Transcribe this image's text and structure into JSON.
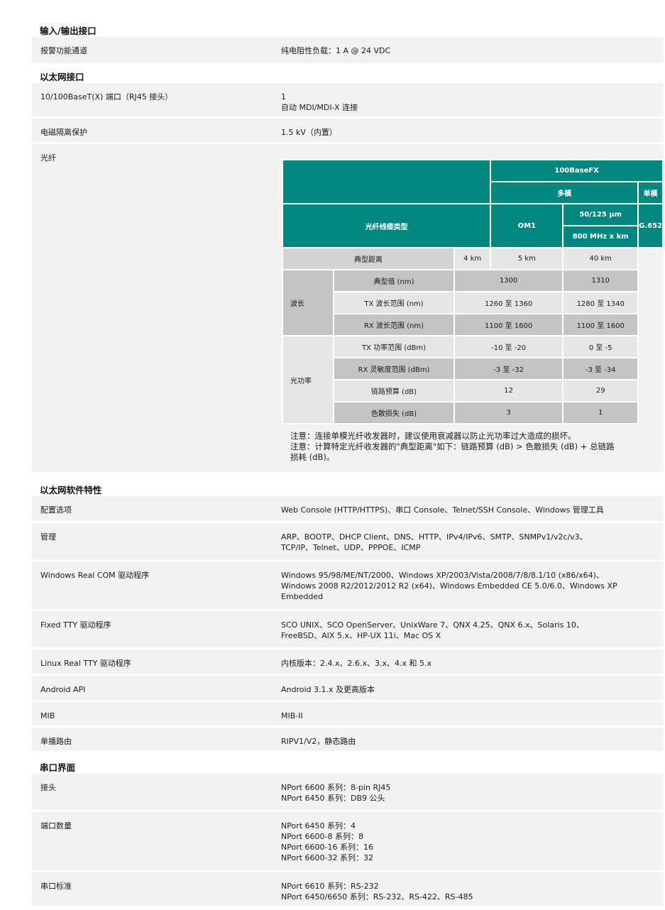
{
  "sections": {
    "io": "输入/输出接口",
    "eth": "以太网接口",
    "sw": "以太网软件特性",
    "serial": "串口界面"
  },
  "io": {
    "alarm_label": "报警功能通道",
    "alarm_value": "纯电阻性负载：1 A @ 24 VDC"
  },
  "eth": {
    "port_label": "10/100BaseT(X) 端口（RJ45 接头）",
    "port_value": [
      "1",
      "自动 MDI/MDI-X 连接"
    ],
    "emi_label": "电磁隔离保护",
    "emi_value": "1.5 kV（内置）",
    "fiber_label": "光纤"
  },
  "fiber": {
    "h100": "100BaseFX",
    "multi": "多模",
    "single": "单模",
    "cable_type": "光纤线缆类型",
    "om1": "OM1",
    "fiber_size": "50/125 µm",
    "bandwidth": "800 MHz x km",
    "g652": "G.652",
    "dist_label": "典型距离",
    "dist": [
      "4 km",
      "5 km",
      "40 km"
    ],
    "wave": "波长",
    "typ_label": "典型值 (nm)",
    "typ_mm": "1300",
    "typ_sm": "1310",
    "tx_label": "TX 波长范围 (nm)",
    "tx_mm": "1260 至 1360",
    "tx_sm": "1280 至 1340",
    "rx_label": "RX 波长范围 (nm)",
    "rx_mm": "1100 至 1600",
    "rx_sm": "1100 至 1600",
    "power": "光功率",
    "txp_label": "TX 功率范围 (dBm)",
    "txp_mm": "-10 至 -20",
    "txp_sm": "0 至 -5",
    "rxs_label": "RX 灵敏度范围 (dBm)",
    "rxs_mm": "-3 至 -32",
    "rxs_sm": "-3 至 -34",
    "budget_label": "链路预算 (dB)",
    "budget_mm": "12",
    "budget_sm": "29",
    "disp_label": "色散损失 (dB)",
    "disp_mm": "3",
    "disp_sm": "1",
    "notes": [
      "注意：连接单模光纤收发器时，建议使用衰减器以防止光功率过大造成的损坏。",
      "注意：计算特定光纤收发器的\"典型距离\"如下：链路预算 (dB) > 色散损失 (dB) + 总链路",
      "损耗 (dB)。"
    ]
  },
  "sw": {
    "config_label": "配置选项",
    "config_value": "Web Console (HTTP/HTTPS)、串口 Console、Telnet/SSH Console、Windows 管理工具",
    "mgmt_label": "管理",
    "mgmt_value": [
      "ARP、BOOTP、DHCP Client、DNS、HTTP、IPv4/IPv6、SMTP、SNMPv1/v2c/v3、",
      "TCP/IP、Telnet、UDP、PPPOE、ICMP"
    ],
    "com_label": "Windows Real COM 驱动程序",
    "com_value": [
      "Windows 95/98/ME/NT/2000、Windows XP/2003/Vista/2008/7/8/8.1/10 (x86/x64)、",
      "Windows 2008 R2/2012/2012 R2 (x64)、Windows Embedded CE 5.0/6.0、Windows XP",
      "Embedded"
    ],
    "tty_label": "Fixed TTY 驱动程序",
    "tty_value": [
      "SCO UNIX、SCO OpenServer、UnixWare 7、QNX 4.25、QNX 6.x、Solaris 10、",
      "FreeBSD、AIX 5.x、HP-UX 11i、Mac OS X"
    ],
    "linux_label": "Linux Real TTY 驱动程序",
    "linux_value": "内核版本：2.4.x、2.6.x、3.x、4.x 和 5.x",
    "android_label": "Android API",
    "android_value": "Android 3.1.x 及更高版本",
    "mib_label": "MIB",
    "mib_value": "MIB-II",
    "route_label": "单播路由",
    "route_value": "RIPV1/V2，静态路由"
  },
  "serial": {
    "conn_label": "接头",
    "conn_value": [
      "NPort 6600 系列：8-pin RJ45",
      "NPort 6450 系列：DB9 公头"
    ],
    "ports_label": "端口数量",
    "ports_value": [
      "NPort 6450 系列：4",
      "NPort 6600-8 系列：8",
      "NPort 6600-16 系列：16",
      "NPort 6600-32 系列：32"
    ],
    "std_label": "串口标准",
    "std_value": [
      "NPort 6610 系列：RS-232",
      "NPort 6450/6650 系列：RS-232、RS-422、RS-485"
    ]
  }
}
